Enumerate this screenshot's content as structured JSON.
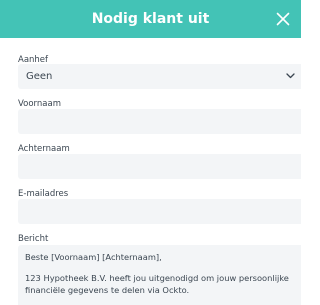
{
  "modal": {
    "title": "Nodig klant uit"
  },
  "form": {
    "salutation": {
      "label": "Aanhef",
      "value": "Geen"
    },
    "first_name": {
      "label": "Voornaam",
      "value": ""
    },
    "last_name": {
      "label": "Achternaam",
      "value": ""
    },
    "email": {
      "label": "E-mailadres",
      "value": ""
    },
    "message": {
      "label": "Bericht",
      "line1": "Beste [Voornaam] [Achternaam],",
      "line2": "123 Hypotheek B.V. heeft jou uitgenodigd om jouw persoonlijke",
      "line3": "financiële gegevens te delen via Ockto."
    }
  },
  "icons": {
    "close": "close-icon",
    "chevron": "chevron-down-icon"
  },
  "colors": {
    "header": "#43c3b6",
    "field_bg": "#f3f5f7",
    "text": "#3b4651"
  }
}
